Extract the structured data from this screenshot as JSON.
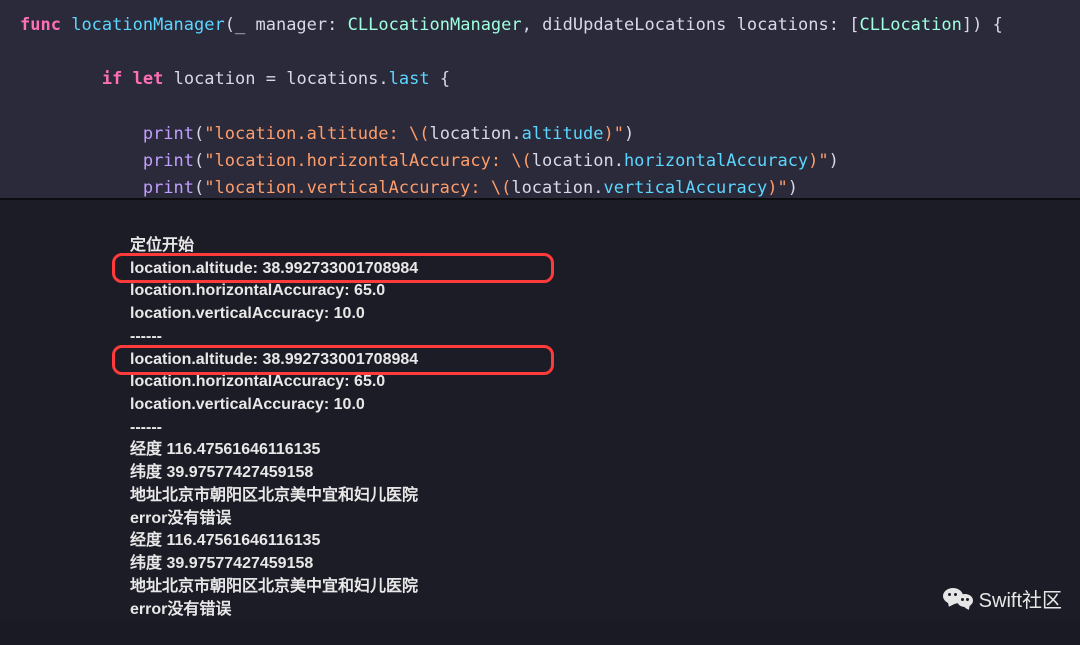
{
  "code": {
    "func_kw": "func",
    "func_name": "locationManager",
    "sig_open": "(",
    "param1_label": "_",
    "param1_name": "manager",
    "colon": ":",
    "param1_type": "CLLocationManager",
    "comma": ",",
    "param2_label": "didUpdateLocations",
    "param2_name": "locations",
    "param2_type_open": "[",
    "param2_type": "CLLocation",
    "param2_type_close": "]",
    "sig_close": ")",
    "brace_open": "{",
    "if_kw": "if",
    "let_kw": "let",
    "let_name": "location",
    "eq": "=",
    "rhs_ident": "locations",
    "rhs_prop": "last",
    "print_fn": "print",
    "str1a": "\"location.altitude: ",
    "str1b": "\\(",
    "interp1_obj": "location",
    "interp1_prop": "altitude",
    "str1c": ")\"",
    "str2a": "\"location.horizontalAccuracy: ",
    "interp2_prop": "horizontalAccuracy",
    "str3a": "\"location.verticalAccuracy: ",
    "interp3_prop": "verticalAccuracy",
    "dot": "."
  },
  "console": {
    "l0": "定位开始",
    "l1": "location.altitude: 38.992733001708984",
    "l2": "location.horizontalAccuracy: 65.0",
    "l3": "location.verticalAccuracy: 10.0",
    "l4": "------",
    "l5": "location.altitude: 38.992733001708984",
    "l6": "location.horizontalAccuracy: 65.0",
    "l7": "location.verticalAccuracy: 10.0",
    "l8": "------",
    "l9": "经度 116.47561646116135",
    "l10": "纬度 39.97577427459158",
    "l11": "地址北京市朝阳区北京美中宜和妇儿医院",
    "l12": "error没有错误",
    "l13": "经度 116.47561646116135",
    "l14": "纬度 39.97577427459158",
    "l15": "地址北京市朝阳区北京美中宜和妇儿医院",
    "l16": "error没有错误"
  },
  "watermark_text": "Swift社区"
}
